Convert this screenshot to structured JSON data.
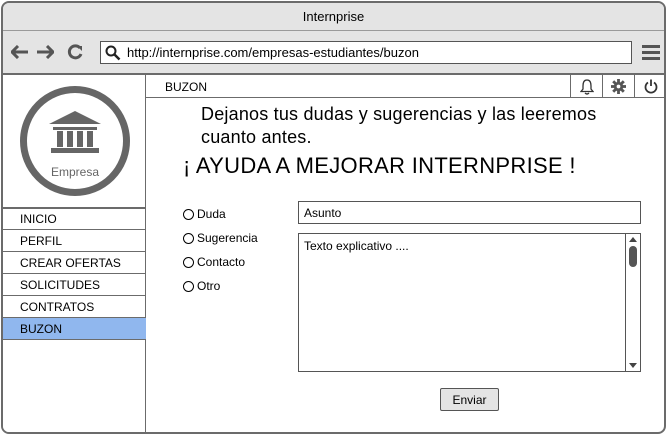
{
  "window": {
    "title": "Internprise"
  },
  "browser": {
    "url": "http://internprise.com/empresas-estudiantes/buzon",
    "icons": [
      "back-arrow-icon",
      "forward-arrow-icon",
      "reload-icon",
      "search-icon",
      "hamburger-menu-icon"
    ]
  },
  "sidebar": {
    "logo_label": "Empresa",
    "items": [
      {
        "label": "INICIO"
      },
      {
        "label": "PERFIL"
      },
      {
        "label": "CREAR OFERTAS"
      },
      {
        "label": "SOLICITUDES"
      },
      {
        "label": "CONTRATOS"
      },
      {
        "label": "BUZON",
        "active": true
      }
    ],
    "active_color": "#90b7ee"
  },
  "header": {
    "section": "BUZON",
    "icons": [
      "bell-icon",
      "gear-icon",
      "power-icon"
    ]
  },
  "main": {
    "intro": "Dejanos tus dudas y sugerencias y las leeremos cuanto antes.",
    "headline": "¡ AYUDA A MEJORAR INTERNPRISE !",
    "options": [
      {
        "label": "Duda"
      },
      {
        "label": "Sugerencia"
      },
      {
        "label": "Contacto"
      },
      {
        "label": "Otro"
      }
    ],
    "subject_value": "Asunto",
    "message_value": "Texto explicativo ....",
    "send_label": "Enviar"
  }
}
